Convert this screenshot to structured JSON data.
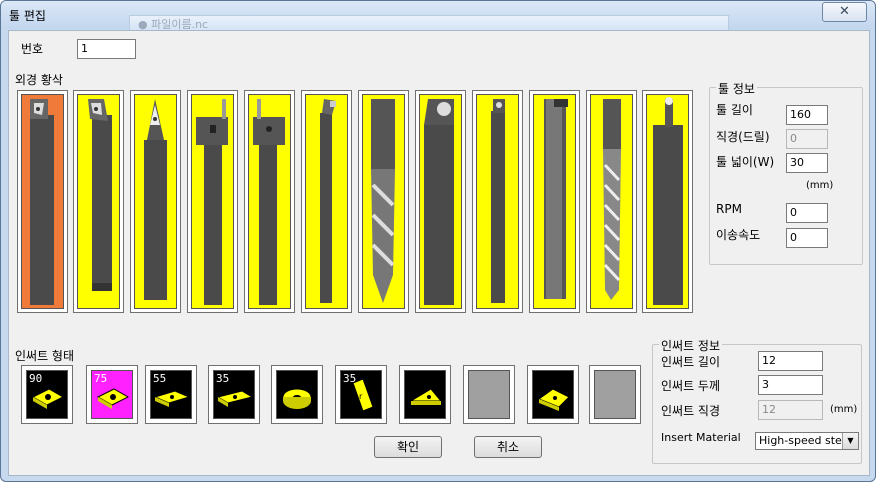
{
  "window": {
    "title": "툴 편집",
    "background_title": "● 파일이름.nc",
    "close_label": "✕"
  },
  "number": {
    "label": "번호",
    "value": "1"
  },
  "tool_section": {
    "label": "외경 황삭",
    "selected_index": 0,
    "tool_count": 12
  },
  "tool_info": {
    "legend": "툴 정보",
    "length_label": "툴 길이",
    "length_value": "160",
    "diameter_label": "직경(드릴)",
    "diameter_value": "0",
    "width_label": "툴 넓이(W)",
    "width_value": "30",
    "unit": "(mm)",
    "rpm_label": "RPM",
    "rpm_value": "0",
    "feed_label": "이송속도",
    "feed_value": "0"
  },
  "insert_section": {
    "label": "인써트 형태",
    "inserts": [
      {
        "angle": "90",
        "selected": false
      },
      {
        "angle": "75",
        "selected": true
      },
      {
        "angle": "55",
        "selected": false
      },
      {
        "angle": "35",
        "selected": false
      },
      {
        "angle": "",
        "selected": false
      },
      {
        "angle": "35",
        "selected": false
      },
      {
        "angle": "",
        "selected": false
      },
      {
        "angle": "",
        "selected": false
      },
      {
        "angle": "",
        "selected": false
      },
      {
        "angle": "",
        "selected": false
      }
    ]
  },
  "insert_info": {
    "legend": "인써트 정보",
    "length_label": "인써트 길이",
    "length_value": "12",
    "thickness_label": "인써트 두께",
    "thickness_value": "3",
    "diameter_label": "인써트 직경",
    "diameter_value": "12",
    "unit": "(mm)",
    "material_label": "Insert Material",
    "material_value": "High-speed steel"
  },
  "buttons": {
    "ok": "확인",
    "cancel": "취소"
  },
  "colors": {
    "tool_bg": "#ffff00",
    "tool_selected": "#f07a3a",
    "insert_selected": "#ff22ff",
    "insert_shape": "#ffff00"
  }
}
